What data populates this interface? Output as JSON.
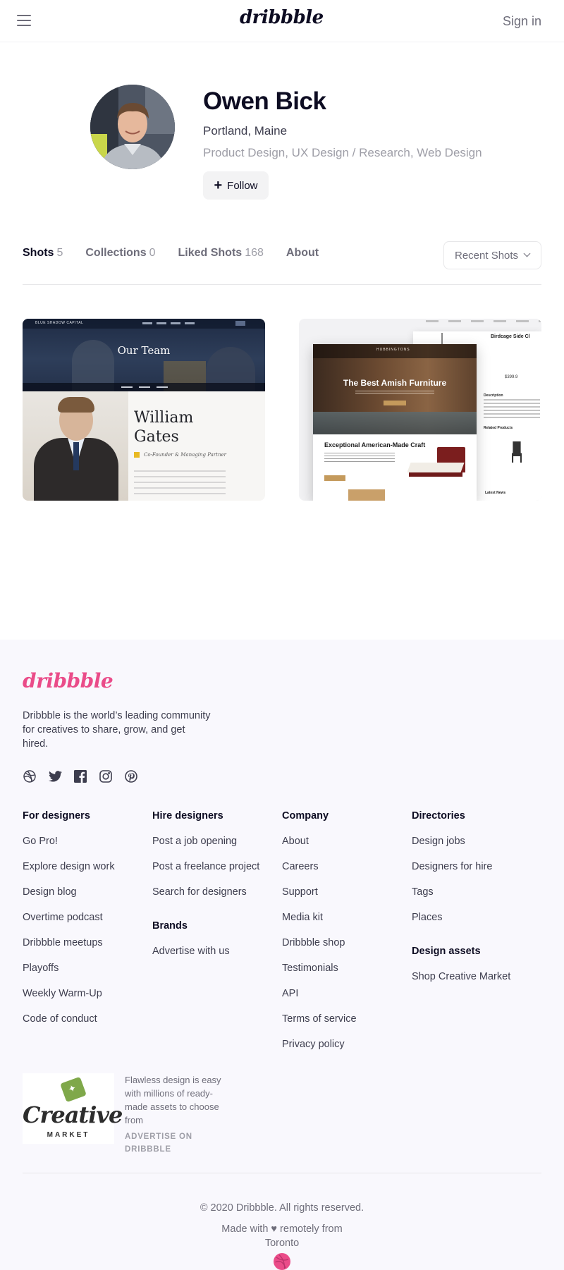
{
  "header": {
    "logo": "dribbble",
    "signin_label": "Sign in",
    "menu_icon": "hamburger-menu-icon"
  },
  "profile": {
    "name": "Owen Bick",
    "location": "Portland, Maine",
    "skills": "Product Design, UX Design / Research, Web Design",
    "follow_label": "Follow",
    "follow_icon": "plus-icon"
  },
  "tabs": [
    {
      "label": "Shots",
      "count": "5",
      "active": true
    },
    {
      "label": "Collections",
      "count": "0",
      "active": false
    },
    {
      "label": "Liked Shots",
      "count": "168",
      "active": false
    },
    {
      "label": "About",
      "count": "",
      "active": false
    }
  ],
  "sort": {
    "selected": "Recent Shots"
  },
  "shots": [
    {
      "hero_title": "Our Team",
      "brand": "BLUE SHADOW CAPITAL",
      "person_name": "William Gates",
      "person_name_l1": "William",
      "person_name_l2": "Gates",
      "role": "Co-Founder & Managing Partner"
    },
    {
      "brand": "HUBBINGTONS",
      "hero_title": "The Best Amish Furniture",
      "section_title": "Exceptional American-Made Craft",
      "product_title": "Birdcage Side Cl",
      "price": "$399.9",
      "description_label": "Description",
      "related_label": "Related Products",
      "news_label": "Latest News"
    }
  ],
  "footer": {
    "logo": "dribbble",
    "tagline": "Dribbble is the world’s leading community for creatives to share, grow, and get hired.",
    "socials": [
      "dribbble-icon",
      "twitter-icon",
      "facebook-icon",
      "instagram-icon",
      "pinterest-icon"
    ],
    "columns": [
      {
        "sections": [
          {
            "head": "For designers",
            "links": [
              "Go Pro!",
              "Explore design work",
              "Design blog",
              "Overtime podcast",
              "Dribbble meetups",
              "Playoffs",
              "Weekly Warm-Up",
              "Code of conduct"
            ]
          }
        ]
      },
      {
        "sections": [
          {
            "head": "Hire designers",
            "links": [
              "Post a job opening",
              "Post a freelance project",
              "Search for designers"
            ]
          },
          {
            "head": "Brands",
            "links": [
              "Advertise with us"
            ]
          }
        ]
      },
      {
        "sections": [
          {
            "head": "Company",
            "links": [
              "About",
              "Careers",
              "Support",
              "Media kit",
              "Dribbble shop",
              "Testimonials",
              "API",
              "Terms of service",
              "Privacy policy"
            ]
          }
        ]
      },
      {
        "sections": [
          {
            "head": "Directories",
            "links": [
              "Design jobs",
              "Designers for hire",
              "Tags",
              "Places"
            ]
          },
          {
            "head": "Design assets",
            "links": [
              "Shop Creative Market"
            ]
          }
        ]
      }
    ],
    "ad": {
      "logo_line1": "Creative",
      "logo_line2": "MARKET",
      "text": "Flawless design is easy with millions of ready-made assets to choose from",
      "cta": "ADVERTISE ON DRIBBBLE"
    },
    "copyright": "© 2020 Dribbble. All rights reserved.",
    "made_with_l1": "Made with ♥ remotely from",
    "made_with_l2": "Toronto"
  },
  "colors": {
    "brand_pink": "#ea4c89",
    "text_dark": "#0d0c22",
    "text_muted": "#6e6d7a",
    "footer_bg": "#f9f8fd"
  }
}
